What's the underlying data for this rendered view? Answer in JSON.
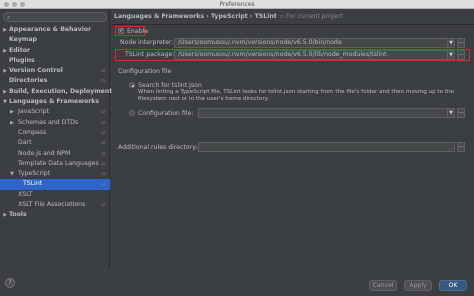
{
  "window": {
    "title": "Preferences"
  },
  "search": {
    "placeholder": ""
  },
  "sidebar": {
    "items": [
      {
        "label": "Appearance & Behavior",
        "bold": true,
        "arrow": "▶",
        "level": 0
      },
      {
        "label": "Keymap",
        "bold": true,
        "arrow": "",
        "level": 0
      },
      {
        "label": "Editor",
        "bold": true,
        "arrow": "▶",
        "level": 0
      },
      {
        "label": "Plugins",
        "bold": true,
        "arrow": "",
        "level": 0
      },
      {
        "label": "Version Control",
        "bold": true,
        "arrow": "▶",
        "level": 0,
        "project": true
      },
      {
        "label": "Directories",
        "bold": true,
        "arrow": "",
        "level": 0,
        "project": true
      },
      {
        "label": "Build, Execution, Deployment",
        "bold": true,
        "arrow": "▶",
        "level": 0
      },
      {
        "label": "Languages & Frameworks",
        "bold": true,
        "arrow": "▼",
        "level": 0
      },
      {
        "label": "JavaScript",
        "bold": false,
        "arrow": "▶",
        "level": 1,
        "project": true
      },
      {
        "label": "Schemas and DTDs",
        "bold": false,
        "arrow": "▶",
        "level": 1,
        "project": true
      },
      {
        "label": "Compass",
        "bold": false,
        "arrow": "",
        "level": 1,
        "project": true
      },
      {
        "label": "Dart",
        "bold": false,
        "arrow": "",
        "level": 1,
        "project": true
      },
      {
        "label": "Node.js and NPM",
        "bold": false,
        "arrow": "",
        "level": 1,
        "project": true
      },
      {
        "label": "Template Data Languages",
        "bold": false,
        "arrow": "",
        "level": 1,
        "project": true
      },
      {
        "label": "TypeScript",
        "bold": false,
        "arrow": "▼",
        "level": 1,
        "project": true
      },
      {
        "label": "TSLint",
        "bold": false,
        "arrow": "",
        "level": 2,
        "selected": true,
        "project": true
      },
      {
        "label": "XSLT",
        "bold": false,
        "arrow": "",
        "level": 1
      },
      {
        "label": "XSLT File Associations",
        "bold": false,
        "arrow": "",
        "level": 1,
        "project": true
      },
      {
        "label": "Tools",
        "bold": true,
        "arrow": "▶",
        "level": 0
      }
    ]
  },
  "breadcrumb": {
    "path": "Languages & Frameworks › TypeScript › TSLint",
    "scope": "For current project"
  },
  "form": {
    "enable_label": "Enable",
    "node_interpreter_label": "Node interpreter:",
    "node_interpreter_value": "/Users/oomusou/.nvm/versions/node/v6.5.0/bin/node",
    "tslint_package_label": "TSLint package:",
    "tslint_package_value": "/Users/oomusou/.nvm/versions/node/v6.5.0/lib/node_modules/tslint",
    "config_section": "Configuration file",
    "search_option": "Search for tslint.json",
    "search_desc": "When linting a TypeScript file, TSLint looks for tslint.json starting from the file's folder and then moving up to the filesystem root or in the user's home directory.",
    "config_option": "Configuration file:",
    "config_value": "",
    "rules_label": "Additional rules directory:",
    "rules_value": ""
  },
  "footer": {
    "help": "?",
    "cancel": "Cancel",
    "apply": "Apply",
    "ok": "OK"
  }
}
